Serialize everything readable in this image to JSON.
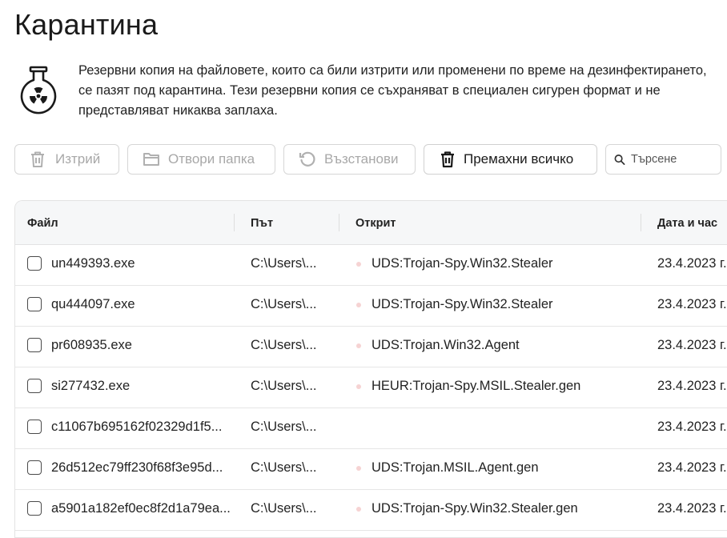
{
  "page": {
    "title": "Карантина"
  },
  "info": {
    "text": "Резервни копия на файловете, които са били изтрити или променени по време на дезинфектирането, се пазят под карантина. Тези резервни копия се съхраняват в специален сигурен формат и не представляват никаква заплаха."
  },
  "toolbar": {
    "delete_label": "Изтрий",
    "open_folder_label": "Отвори папка",
    "restore_label": "Възстанови",
    "remove_all_label": "Премахни всичко",
    "search_placeholder": "Търсене"
  },
  "table": {
    "columns": {
      "file": "Файл",
      "path": "Път",
      "detected": "Открит",
      "datetime": "Дата и час"
    },
    "rows": [
      {
        "file": "un449393.exe",
        "path": "C:\\Users\\...",
        "detected": "UDS:Trojan-Spy.Win32.Stealer",
        "datetime": "23.4.2023 г."
      },
      {
        "file": "qu444097.exe",
        "path": "C:\\Users\\...",
        "detected": "UDS:Trojan-Spy.Win32.Stealer",
        "datetime": "23.4.2023 г."
      },
      {
        "file": "pr608935.exe",
        "path": "C:\\Users\\...",
        "detected": "UDS:Trojan.Win32.Agent",
        "datetime": "23.4.2023 г."
      },
      {
        "file": "si277432.exe",
        "path": "C:\\Users\\...",
        "detected": "HEUR:Trojan-Spy.MSIL.Stealer.gen",
        "datetime": "23.4.2023 г."
      },
      {
        "file": "c11067b695162f02329d1f5...",
        "path": "C:\\Users\\...",
        "detected": "",
        "datetime": "23.4.2023 г."
      },
      {
        "file": "26d512ec79ff230f68f3e95d...",
        "path": "C:\\Users\\...",
        "detected": "UDS:Trojan.MSIL.Agent.gen",
        "datetime": "23.4.2023 г."
      },
      {
        "file": "a5901a182ef0ec8f2d1a79ea...",
        "path": "C:\\Users\\...",
        "detected": "UDS:Trojan-Spy.Win32.Stealer.gen",
        "datetime": "23.4.2023 г."
      }
    ]
  },
  "icons": {
    "info": "radiation-flask-icon",
    "delete": "trash-icon",
    "open": "folder-icon",
    "restore": "restore-icon",
    "remove_all": "trash-icon",
    "search": "search-icon"
  },
  "colors": {
    "threat_dot": "#f6d3d3",
    "header_bg": "#f6f7f8",
    "disabled_text": "#a8a8a8"
  }
}
